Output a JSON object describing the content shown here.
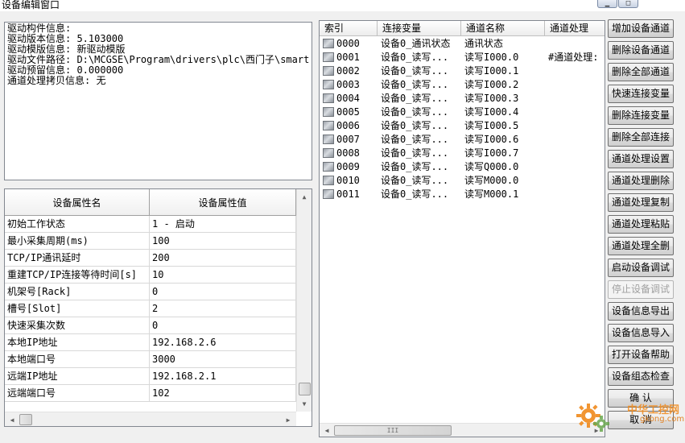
{
  "window": {
    "title": "设备编辑窗口",
    "buttons": [
      "minimize-icon",
      "maximize-icon"
    ]
  },
  "info": {
    "lines": [
      "驱动构件信息:",
      "驱动版本信息: 5.103000",
      "驱动模版信息: 新驱动模版",
      "驱动文件路径: D:\\MCGSE\\Program\\drivers\\plc\\西门子\\smart",
      "驱动预留信息: 0.000000",
      "通道处理拷贝信息: 无"
    ]
  },
  "properties": {
    "headers": [
      "设备属性名",
      "设备属性值"
    ],
    "rows": [
      {
        "name": "初始工作状态",
        "value": "1 - 启动"
      },
      {
        "name": "最小采集周期(ms)",
        "value": "100"
      },
      {
        "name": "TCP/IP通讯延时",
        "value": "200"
      },
      {
        "name": "重建TCP/IP连接等待时间[s]",
        "value": "10"
      },
      {
        "name": "机架号[Rack]",
        "value": "0"
      },
      {
        "name": "槽号[Slot]",
        "value": "2"
      },
      {
        "name": "快速采集次数",
        "value": "0"
      },
      {
        "name": "本地IP地址",
        "value": "192.168.2.6"
      },
      {
        "name": "本地端口号",
        "value": "3000"
      },
      {
        "name": "远端IP地址",
        "value": "192.168.2.1"
      },
      {
        "name": "远端端口号",
        "value": "102"
      }
    ]
  },
  "channels": {
    "headers": [
      "索引",
      "连接变量",
      "通道名称",
      "通道处理"
    ],
    "rows": [
      {
        "index": "0000",
        "variable": "设备0_通讯状态",
        "name": "通讯状态",
        "process": ""
      },
      {
        "index": "0001",
        "variable": "设备0_读写...",
        "name": "读写I000.0",
        "process": "#通道处理:"
      },
      {
        "index": "0002",
        "variable": "设备0_读写...",
        "name": "读写I000.1",
        "process": ""
      },
      {
        "index": "0003",
        "variable": "设备0_读写...",
        "name": "读写I000.2",
        "process": ""
      },
      {
        "index": "0004",
        "variable": "设备0_读写...",
        "name": "读写I000.3",
        "process": ""
      },
      {
        "index": "0005",
        "variable": "设备0_读写...",
        "name": "读写I000.4",
        "process": ""
      },
      {
        "index": "0006",
        "variable": "设备0_读写...",
        "name": "读写I000.5",
        "process": ""
      },
      {
        "index": "0007",
        "variable": "设备0_读写...",
        "name": "读写I000.6",
        "process": ""
      },
      {
        "index": "0008",
        "variable": "设备0_读写...",
        "name": "读写I000.7",
        "process": ""
      },
      {
        "index": "0009",
        "variable": "设备0_读写...",
        "name": "读写Q000.0",
        "process": ""
      },
      {
        "index": "0010",
        "variable": "设备0_读写...",
        "name": "读写M000.0",
        "process": ""
      },
      {
        "index": "0011",
        "variable": "设备0_读写...",
        "name": "读写M000.1",
        "process": ""
      }
    ],
    "hscroll_grip": "III"
  },
  "buttons": [
    {
      "label": "增加设备通道",
      "enabled": true
    },
    {
      "label": "删除设备通道",
      "enabled": true
    },
    {
      "label": "删除全部通道",
      "enabled": true
    },
    {
      "label": "快速连接变量",
      "enabled": true
    },
    {
      "label": "删除连接变量",
      "enabled": true
    },
    {
      "label": "删除全部连接",
      "enabled": true
    },
    {
      "label": "通道处理设置",
      "enabled": true
    },
    {
      "label": "通道处理删除",
      "enabled": true
    },
    {
      "label": "通道处理复制",
      "enabled": true
    },
    {
      "label": "通道处理粘贴",
      "enabled": true
    },
    {
      "label": "通道处理全删",
      "enabled": true
    },
    {
      "label": "启动设备调试",
      "enabled": true
    },
    {
      "label": "停止设备调试",
      "enabled": false
    },
    {
      "label": "设备信息导出",
      "enabled": true
    },
    {
      "label": "设备信息导入",
      "enabled": true
    },
    {
      "label": "打开设备帮助",
      "enabled": true
    },
    {
      "label": "设备组态检查",
      "enabled": true
    },
    {
      "label": "确   认",
      "enabled": true
    },
    {
      "label": "取   消",
      "enabled": true
    }
  ],
  "watermark": {
    "site_name": "中华工控网",
    "url": "gkong.com"
  },
  "colors": {
    "window_bg": "#f0f0f0",
    "border": "#828790",
    "disabled_text": "#a0a0a0",
    "watermark_orange": "#f08a1c",
    "watermark_green": "#6aa84f"
  }
}
